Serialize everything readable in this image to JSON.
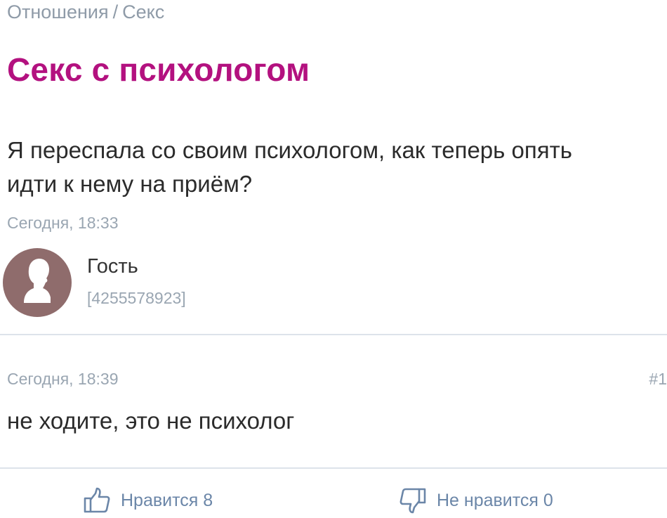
{
  "breadcrumb": {
    "parent": "Отношения",
    "separator": "/",
    "current": "Секс"
  },
  "question": {
    "title": "Секс с психологом",
    "line1": "Я переспала со своим психологом, как теперь опять",
    "line2": "идти к нему на приём?",
    "time": "Сегодня, 18:33",
    "author_name": "Гость",
    "author_id": "[4255578923]"
  },
  "answer": {
    "time": "Сегодня, 18:39",
    "number": "#1",
    "text": "не ходите, это не психолог"
  },
  "votes": {
    "like_label": "Нравится 8",
    "dislike_label": "Не нравится 0",
    "icon_color": "#6b86a8"
  },
  "icons": {
    "like": "thumbs-up-icon",
    "dislike": "thumbs-down-icon",
    "avatar": "user-silhouette-icon"
  },
  "colors": {
    "title": "#b3117f",
    "muted": "#9aa6b2",
    "avatar_bg": "#8f6c6c"
  }
}
